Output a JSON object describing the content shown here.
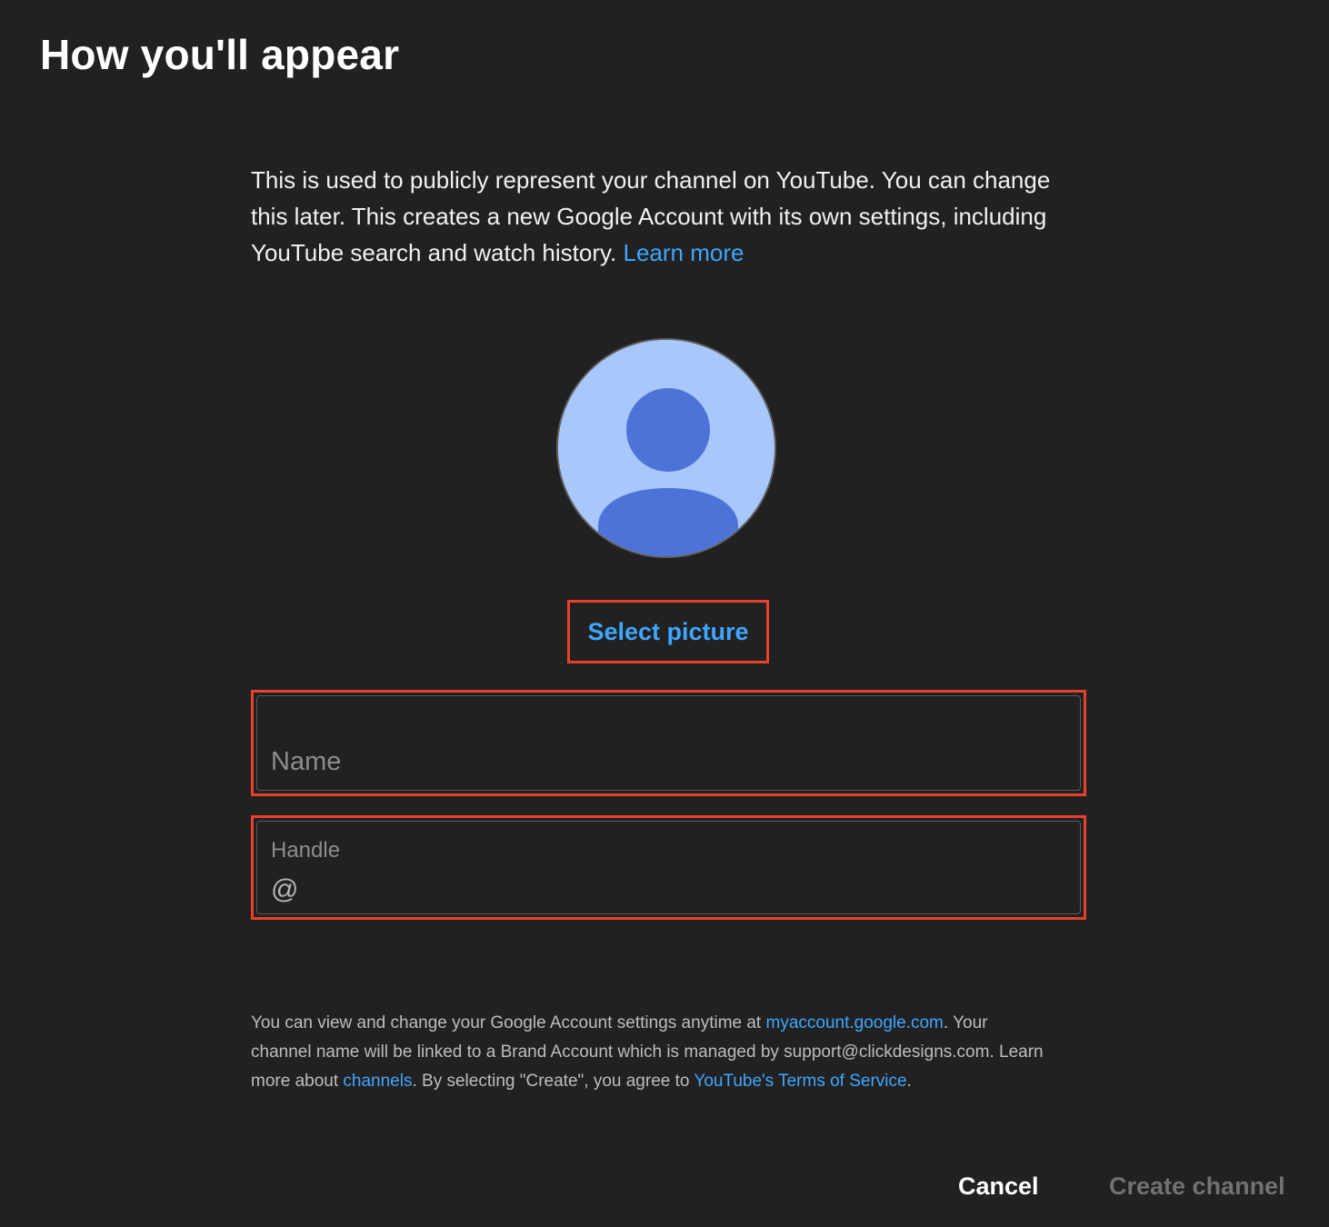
{
  "dialog": {
    "title": "How you'll appear",
    "intro_text": "This is used to publicly represent your channel on YouTube. You can change this later. This creates a new Google Account with its own settings, including YouTube search and watch history. ",
    "learn_more_link": "Learn more"
  },
  "avatar": {
    "icon": "default-profile-avatar-icon",
    "background_color": "#a8c7fa",
    "figure_color": "#4e73d8"
  },
  "select_picture_label": "Select picture",
  "form": {
    "name": {
      "placeholder": "Name",
      "value": ""
    },
    "handle": {
      "label": "Handle",
      "prefix": "@",
      "value": ""
    }
  },
  "footnote": {
    "part1": "You can view and change your Google Account settings anytime at ",
    "link1": "myaccount.google.com",
    "part2": ". Your channel name will be linked to a Brand Account which is managed by support@clickdesigns.com. Learn more about ",
    "link2": "channels",
    "part3": ". By selecting \"Create\", you agree to ",
    "link3": "YouTube's Terms of Service",
    "part4": "."
  },
  "buttons": {
    "cancel": "Cancel",
    "create": "Create channel"
  },
  "colors": {
    "background": "#212121",
    "link": "#3ea6ff",
    "highlight_outline": "#e8402b",
    "disabled_text": "#717171"
  }
}
